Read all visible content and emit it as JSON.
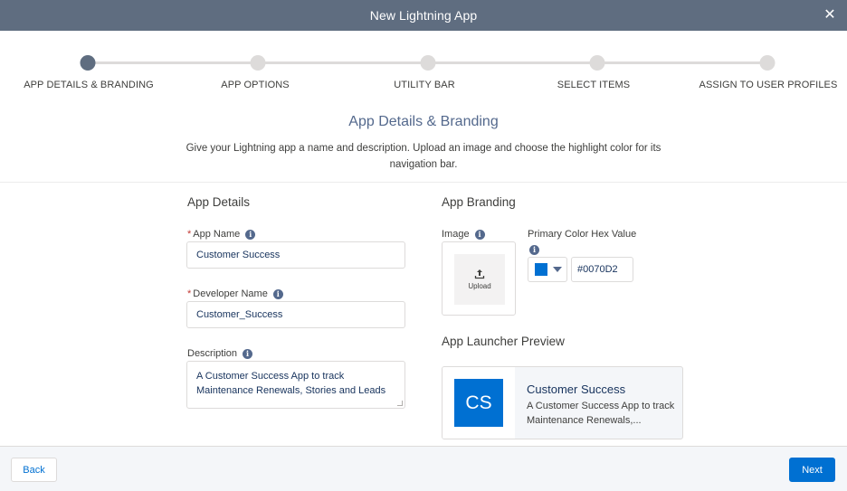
{
  "modal": {
    "title": "New Lightning App",
    "close_icon": "close-icon"
  },
  "steps": [
    {
      "label": "APP DETAILS & BRANDING",
      "active": true
    },
    {
      "label": "APP OPTIONS",
      "active": false
    },
    {
      "label": "UTILITY BAR",
      "active": false
    },
    {
      "label": "SELECT ITEMS",
      "active": false
    },
    {
      "label": "ASSIGN TO USER PROFILES",
      "active": false
    }
  ],
  "section": {
    "title": "App Details & Branding",
    "description": "Give your Lightning app a name and description. Upload an image and choose the highlight color for its navigation bar."
  },
  "app_details": {
    "title": "App Details",
    "required_marker": "*",
    "app_name": {
      "label": "App Name",
      "value": "Customer Success"
    },
    "developer_name": {
      "label": "Developer Name",
      "value": "Customer_Success"
    },
    "description": {
      "label": "Description",
      "value": "A Customer Success App to track Maintenance Renewals, Stories and Leads"
    }
  },
  "app_branding": {
    "title": "App Branding",
    "image_label": "Image",
    "upload_label": "Upload",
    "color_label": "Primary Color Hex Value",
    "color_value": "#0070D2",
    "info_icon": "i"
  },
  "preview": {
    "title": "App Launcher Preview",
    "initials": "CS",
    "name": "Customer Success",
    "description": "A Customer Success App to track Maintenance Renewals,..."
  },
  "footer": {
    "back_label": "Back",
    "next_label": "Next"
  },
  "colors": {
    "header": "#5f6d80",
    "brand": "#0070d2",
    "step_active": "#5f6d80",
    "step_inactive": "#dddbda"
  }
}
